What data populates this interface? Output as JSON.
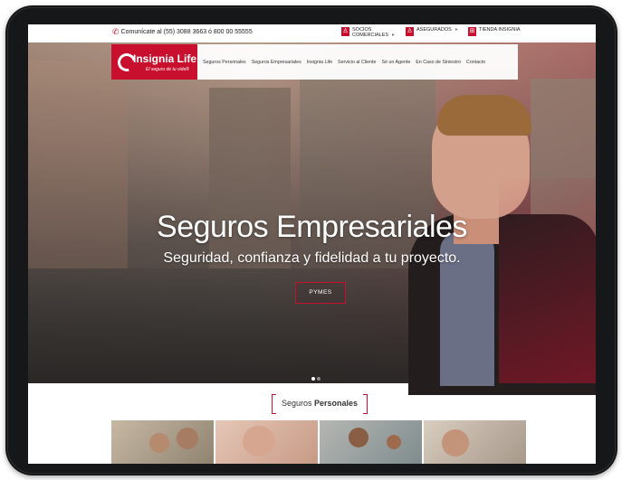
{
  "topbar": {
    "phone_text": "Comunícate al (55) 3088 3663 ó 800 00 55555",
    "links": [
      {
        "label_line1": "SOCIOS",
        "label_line2": "COMERCIALES",
        "icon": "user-icon"
      },
      {
        "label_line1": "ASEGURADOS",
        "label_line2": "",
        "icon": "user-icon"
      },
      {
        "label_line1": "TIENDA INSIGNIA",
        "label_line2": "",
        "icon": "cart-icon"
      }
    ]
  },
  "logo": {
    "name": "Insignia Life",
    "tagline": "El seguro de tu vida®"
  },
  "nav": {
    "items": [
      "Seguros Personales",
      "Seguros Empresariales",
      "Insignia Life",
      "Servicio al Cliente",
      "Sé un Agente",
      "En Caso de Siniestro",
      "Contacto"
    ]
  },
  "hero": {
    "title": "Seguros Empresariales",
    "subtitle": "Seguridad, confianza y fidelidad a tu proyecto.",
    "button": "PYMES",
    "slides": 2,
    "active_slide": 0
  },
  "section": {
    "title_plain": "Seguros ",
    "title_bold": "Personales"
  },
  "colors": {
    "brand_red": "#c8102e",
    "frame": "#161718"
  }
}
